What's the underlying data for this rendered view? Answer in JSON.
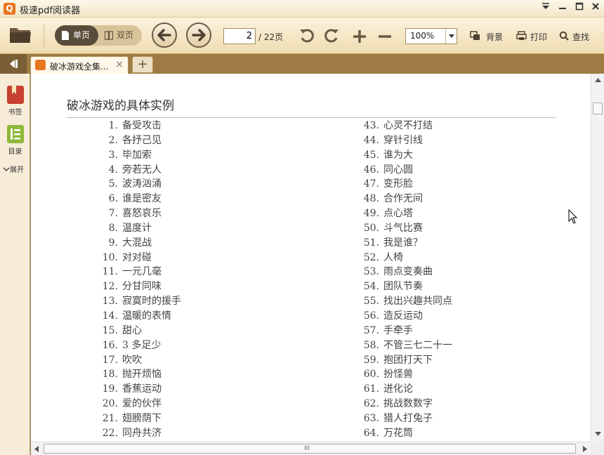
{
  "window": {
    "title": "极速pdf阅读器"
  },
  "toolbar": {
    "single_page": "单页",
    "double_page": "双页",
    "current_page": "2",
    "total_pages": "/ 22页",
    "zoom": "100%",
    "background": "背景",
    "print": "打印",
    "find": "查找"
  },
  "tabs": {
    "doc_tab": "破冰游戏全集...",
    "close": "×",
    "add": "+"
  },
  "sidebar": {
    "bookmarks": "书签",
    "toc": "目录",
    "expand": "展开"
  },
  "document": {
    "heading": "破冰游戏的具体实例",
    "left_items": [
      {
        "n": "1.",
        "t": "备受攻击"
      },
      {
        "n": "2.",
        "t": "各抒己见"
      },
      {
        "n": "3.",
        "t": "毕加索"
      },
      {
        "n": "4.",
        "t": "旁若无人"
      },
      {
        "n": "5.",
        "t": "波涛汹涌"
      },
      {
        "n": "6.",
        "t": "谁是密友"
      },
      {
        "n": "7.",
        "t": "喜怒哀乐"
      },
      {
        "n": "8.",
        "t": "温度计"
      },
      {
        "n": "9.",
        "t": "大混战"
      },
      {
        "n": "10.",
        "t": "对对碰"
      },
      {
        "n": "11.",
        "t": "一元几毫"
      },
      {
        "n": "12.",
        "t": "分甘同味"
      },
      {
        "n": "13.",
        "t": "寂寞时的援手"
      },
      {
        "n": "14.",
        "t": "温暖的表情"
      },
      {
        "n": "15.",
        "t": "甜心"
      },
      {
        "n": "16.",
        "t": "3 多足少"
      },
      {
        "n": "17.",
        "t": "吹吹"
      },
      {
        "n": "18.",
        "t": "抛开烦恼"
      },
      {
        "n": "19.",
        "t": "香蕉运动"
      },
      {
        "n": "20.",
        "t": "爱的伙伴"
      },
      {
        "n": "21.",
        "t": "翅膀荫下"
      },
      {
        "n": "22.",
        "t": "同舟共济"
      }
    ],
    "right_items": [
      {
        "n": "43.",
        "t": "心灵不打结"
      },
      {
        "n": "44.",
        "t": "穿针引线"
      },
      {
        "n": "45.",
        "t": "谁为大"
      },
      {
        "n": "46.",
        "t": "同心圆"
      },
      {
        "n": "47.",
        "t": "变形脸"
      },
      {
        "n": "48.",
        "t": "合作无间"
      },
      {
        "n": "49.",
        "t": "点心塔"
      },
      {
        "n": "50.",
        "t": "斗气比赛"
      },
      {
        "n": "51.",
        "t": "我是谁？"
      },
      {
        "n": "52.",
        "t": "人椅"
      },
      {
        "n": "53.",
        "t": "雨点变奏曲"
      },
      {
        "n": "54.",
        "t": "团队节奏"
      },
      {
        "n": "55.",
        "t": "找出兴趣共同点"
      },
      {
        "n": "56.",
        "t": "造反运动"
      },
      {
        "n": "57.",
        "t": "手牵手"
      },
      {
        "n": "58.",
        "t": "不管三七二十一"
      },
      {
        "n": "59.",
        "t": "抱团打天下"
      },
      {
        "n": "60.",
        "t": "扮怪兽"
      },
      {
        "n": "61.",
        "t": "进化论"
      },
      {
        "n": "62.",
        "t": "挑战数数字"
      },
      {
        "n": "63.",
        "t": "猎人打兔子"
      },
      {
        "n": "64.",
        "t": "万花筒"
      }
    ]
  },
  "scrollbar": {
    "h_grip": "III"
  }
}
